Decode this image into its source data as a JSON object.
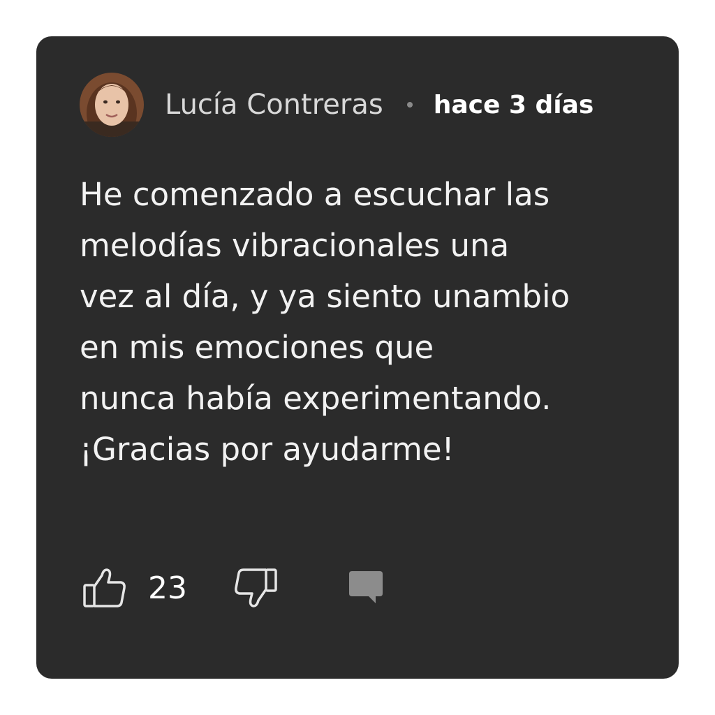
{
  "comment": {
    "author": "Lucía Contreras",
    "timestamp": "hace 3 días",
    "text_lines": [
      "He comenzado a escuchar las",
      "melodías vibracionales una",
      "vez al día, y ya siento unambio",
      "en mis emociones que",
      "nunca había experimentando.",
      "¡Gracias por ayudarme!"
    ],
    "likes": "23"
  },
  "icons": {
    "like": "thumbs-up-icon",
    "dislike": "thumbs-down-icon",
    "reply": "comment-bubble-icon"
  },
  "colors": {
    "card_background": "#2b2b2b",
    "page_background": "#ffffff",
    "text": "#f2f2f2",
    "icon_reply": "#8c8c8c"
  }
}
